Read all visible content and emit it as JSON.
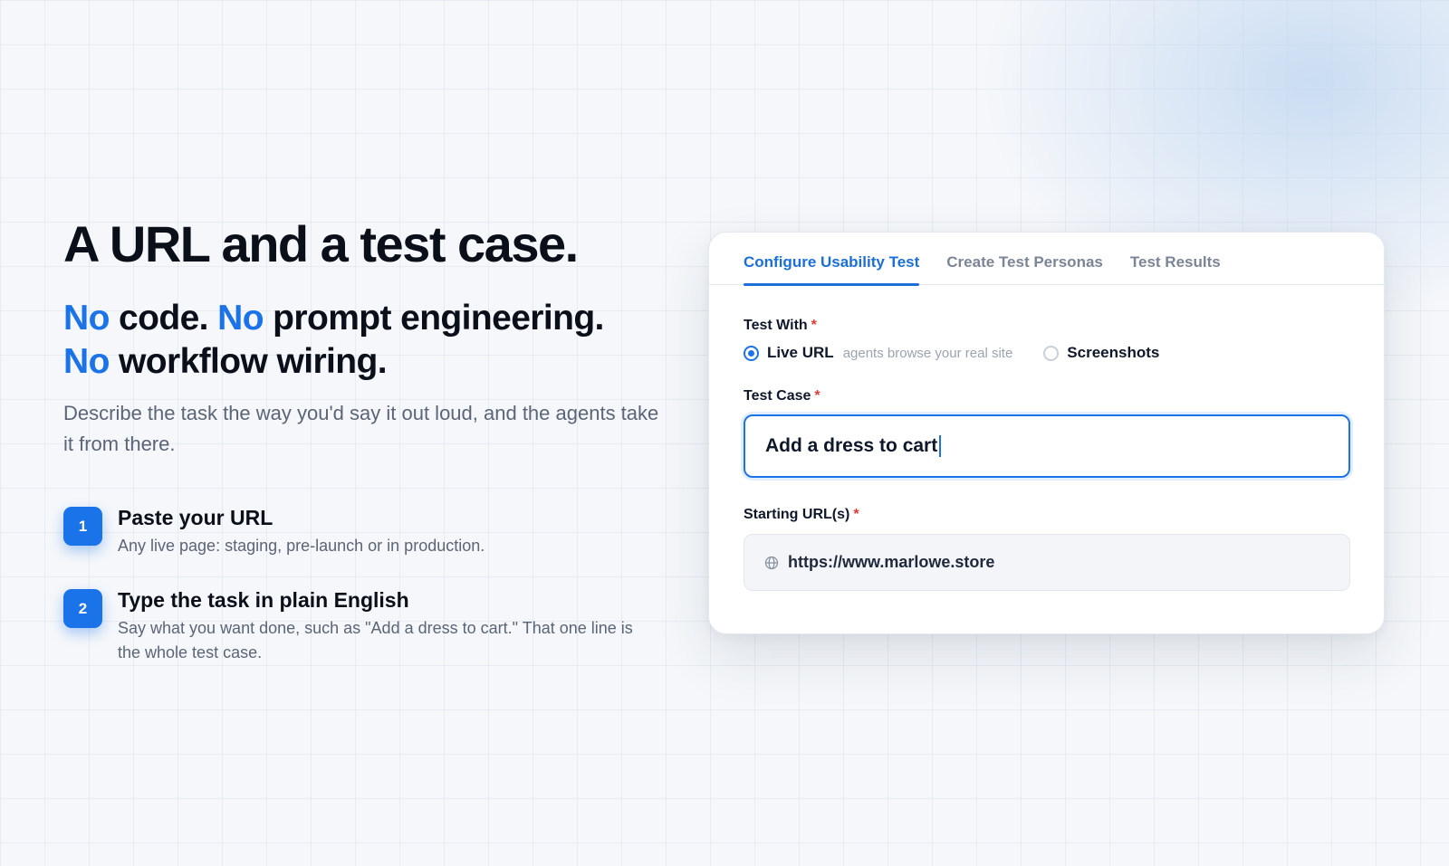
{
  "hero": {
    "headline": "A URL and a test case.",
    "sub_line1": [
      {
        "text": "No",
        "accent": true
      },
      {
        "text": " code. ",
        "accent": false
      },
      {
        "text": "No",
        "accent": true
      },
      {
        "text": " prompt engineering.",
        "accent": false
      }
    ],
    "sub_line2": [
      {
        "text": "No",
        "accent": true
      },
      {
        "text": " workflow wiring.",
        "accent": false
      }
    ],
    "description": "Describe the task the way you'd say it out loud, and the agents take it from there."
  },
  "steps": [
    {
      "number": "1",
      "title": "Paste your URL",
      "text": "Any live page: staging, pre-launch or in production."
    },
    {
      "number": "2",
      "title": "Type the task in plain English",
      "text": "Say what you want done, such as \"Add a dress to cart.\" That one line is the whole test case."
    }
  ],
  "card": {
    "tabs": [
      {
        "label": "Configure Usability Test",
        "active": true
      },
      {
        "label": "Create Test Personas",
        "active": false
      },
      {
        "label": "Test Results",
        "active": false
      }
    ],
    "test_with": {
      "label": "Test With",
      "required_mark": "*",
      "options": [
        {
          "label": "Live URL",
          "hint": "agents browse your real site",
          "selected": true
        },
        {
          "label": "Screenshots",
          "hint": "",
          "selected": false
        }
      ]
    },
    "test_case": {
      "label": "Test Case",
      "required_mark": "*",
      "value": "Add a dress to cart"
    },
    "starting_url": {
      "label": "Starting URL(s)",
      "required_mark": "*",
      "icon": "globe-icon",
      "value": "https://www.marlowe.store"
    }
  },
  "colors": {
    "accent": "#1a73e8",
    "required": "#e53935",
    "text_dark": "#0b0f19",
    "text_muted": "#5b6576"
  }
}
